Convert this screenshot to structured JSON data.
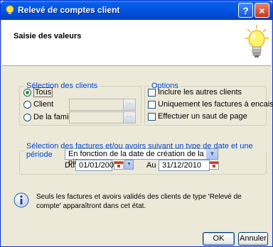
{
  "window": {
    "title": "Relevé de comptes client",
    "help_button": "?",
    "close_button": "×"
  },
  "header": {
    "title": "Saisie des valeurs"
  },
  "client_selection": {
    "legend": "Sélection des clients",
    "options": [
      {
        "label": "Tous",
        "selected": true
      },
      {
        "label": "Client",
        "selected": false
      },
      {
        "label": "De la famille",
        "selected": false
      }
    ],
    "client_value": "",
    "family_value": ""
  },
  "options": {
    "legend": "Options",
    "checkboxes": [
      {
        "label": "Inclure les autres clients",
        "checked": false
      },
      {
        "label": "Uniquement les factures à encaisser",
        "checked": false
      },
      {
        "label": "Effectuer un saut de page",
        "checked": false
      }
    ]
  },
  "date_selection": {
    "legend": "Sélection des factures et/ou avoirs suivant un type de date et une période",
    "date_type": "En fonction de la date de création de la pièce",
    "from_label": "Du",
    "from_value": "01/01/2000",
    "to_label": "Au",
    "to_value": "31/12/2010"
  },
  "info": {
    "text": "Seuls les factures et avoirs validés des clients de type 'Relevé de compte' apparaîtront dans cet état."
  },
  "buttons": {
    "ok": "OK",
    "cancel": "Annuler"
  },
  "colors": {
    "titlebar": "#0054e3",
    "legend_text": "#0046d5",
    "dialog_bg": "#ece9d8"
  }
}
